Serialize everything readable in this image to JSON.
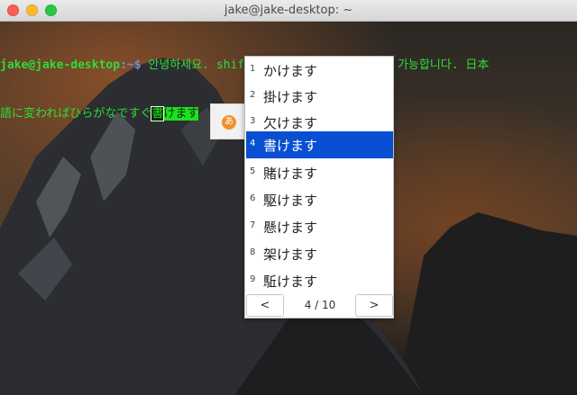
{
  "window": {
    "title": "jake@jake-desktop: ~"
  },
  "terminal": {
    "prompt_user": "jake@jake-desktop",
    "prompt_path": ":~$",
    "line1_text": " 안녕하세요. shift + alt 로 일본어 변환이 가능합니다. 日本",
    "line2_text": "語に変わればひらがなですぐ",
    "preedit_cursor": "書",
    "preedit_rest": "けます"
  },
  "ime_indicator": {
    "icon": "hiragana-a-icon",
    "glyph": "あ",
    "color": "#f3902c"
  },
  "candidate_window": {
    "candidates": [
      {
        "num": "1",
        "word": "かけます"
      },
      {
        "num": "2",
        "word": "掛けます"
      },
      {
        "num": "3",
        "word": "欠けます"
      },
      {
        "num": "4",
        "word": "書けます"
      },
      {
        "num": "5",
        "word": "賭けます"
      },
      {
        "num": "6",
        "word": "駆けます"
      },
      {
        "num": "7",
        "word": "懸けます"
      },
      {
        "num": "8",
        "word": "架けます"
      },
      {
        "num": "9",
        "word": "駈けます"
      }
    ],
    "selected_index": 3,
    "selected_color": "#0a4fd1",
    "prev_label": "<",
    "next_label": ">",
    "page_indicator": "4 / 10"
  }
}
